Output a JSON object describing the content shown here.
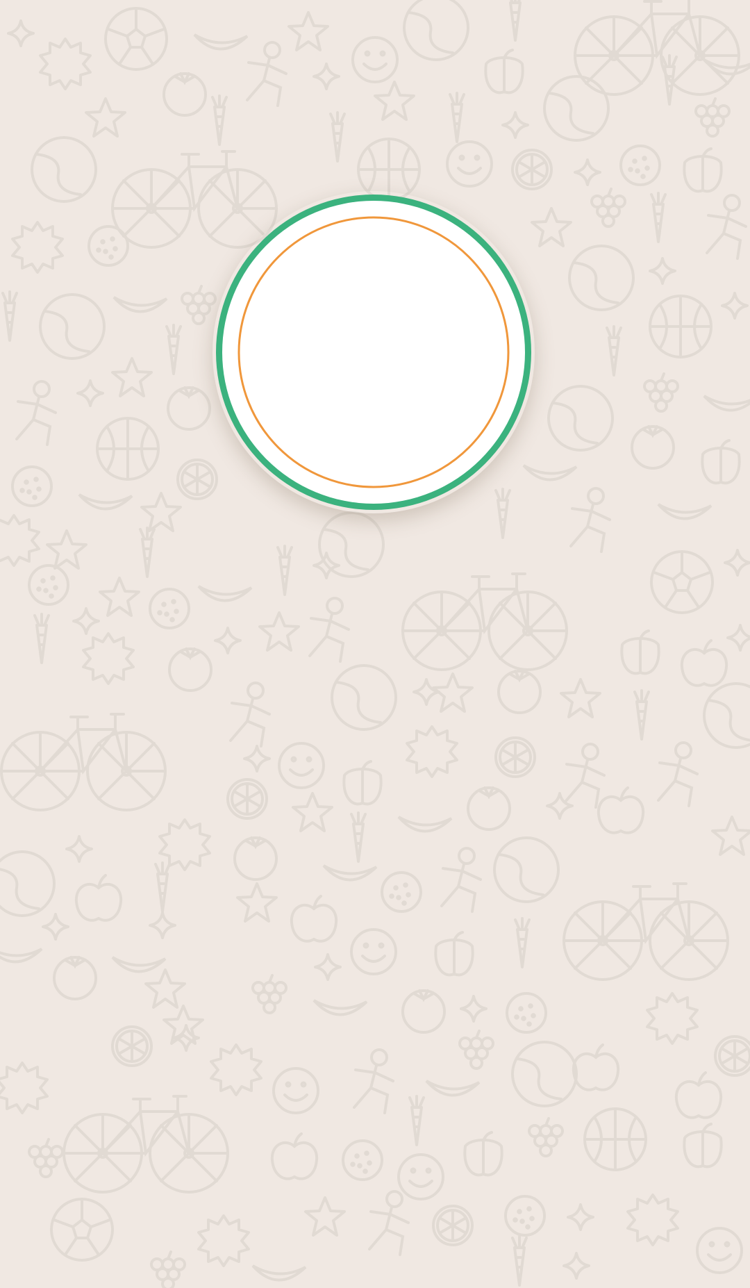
{
  "theme": {
    "background": "#F0E8E2",
    "doodle_stroke": "#E1DAD3",
    "ring_outer": "#3BB27E",
    "ring_fill": "#FFFFFF",
    "ring_inner": "#F0973B"
  },
  "wallpaper": {
    "pattern_icons": [
      "bicycle-icon",
      "soccer-ball-icon",
      "basketball-icon",
      "tennis-ball-icon",
      "star-icon",
      "sparkle-icon",
      "smiley-icon",
      "apple-icon",
      "tomato-icon",
      "carrot-icon",
      "banana-icon",
      "grapes-icon",
      "pepper-icon",
      "citrus-slice-icon",
      "orange-icon",
      "running-person-icon",
      "burst-icon"
    ]
  },
  "splash": {
    "logo_icon": "ring-logo-icon"
  }
}
